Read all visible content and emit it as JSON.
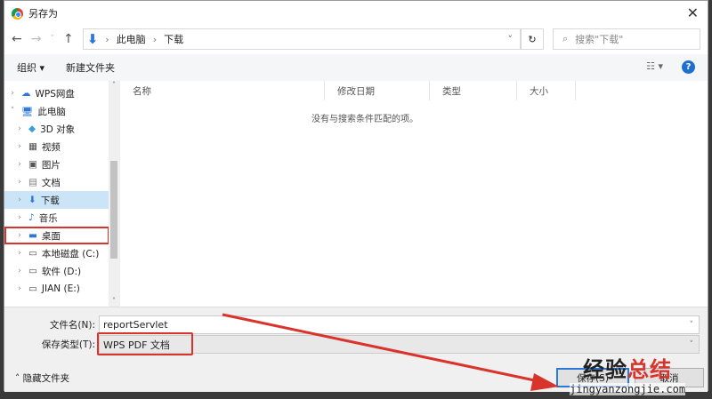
{
  "title": "另存为",
  "address": {
    "crumbs": [
      "此电脑",
      "下载"
    ],
    "search_placeholder": "搜索\"下载\""
  },
  "toolbar": {
    "organize": "组织 ▾",
    "new_folder": "新建文件夹",
    "help": "?"
  },
  "sidebar": [
    {
      "label": "WPS网盘",
      "icon": "cloud-icon",
      "indent": 0,
      "expanded": false
    },
    {
      "label": "此电脑",
      "icon": "computer-icon",
      "indent": 0,
      "expanded": true
    },
    {
      "label": "3D 对象",
      "icon": "cube-icon",
      "indent": 1
    },
    {
      "label": "视频",
      "icon": "video-icon",
      "indent": 1
    },
    {
      "label": "图片",
      "icon": "picture-icon",
      "indent": 1
    },
    {
      "label": "文档",
      "icon": "document-icon",
      "indent": 1
    },
    {
      "label": "下载",
      "icon": "download-icon",
      "indent": 1,
      "selected": true
    },
    {
      "label": "音乐",
      "icon": "music-icon",
      "indent": 1
    },
    {
      "label": "桌面",
      "icon": "desktop-icon",
      "indent": 1,
      "highlighted": true
    },
    {
      "label": "本地磁盘 (C:)",
      "icon": "drive-icon",
      "indent": 1
    },
    {
      "label": "软件 (D:)",
      "icon": "drive-icon",
      "indent": 1
    },
    {
      "label": "JIAN (E:)",
      "icon": "drive-icon",
      "indent": 1
    }
  ],
  "columns": [
    "名称",
    "修改日期",
    "类型",
    "大小"
  ],
  "empty_message": "没有与搜索条件匹配的项。",
  "filename": {
    "label": "文件名(N):",
    "value": "reportServlet"
  },
  "filetype": {
    "label": "保存类型(T):",
    "value": "WPS PDF 文档"
  },
  "hide_folders": "隐藏文件夹",
  "buttons": {
    "save": "保存(S)",
    "cancel": "取消"
  },
  "watermark": {
    "line1a": "经验",
    "line1b": "总结",
    "line2": "jingyanzongjie.com"
  },
  "colors": {
    "accent": "#2b78d6",
    "annotation": "#d9342b"
  }
}
